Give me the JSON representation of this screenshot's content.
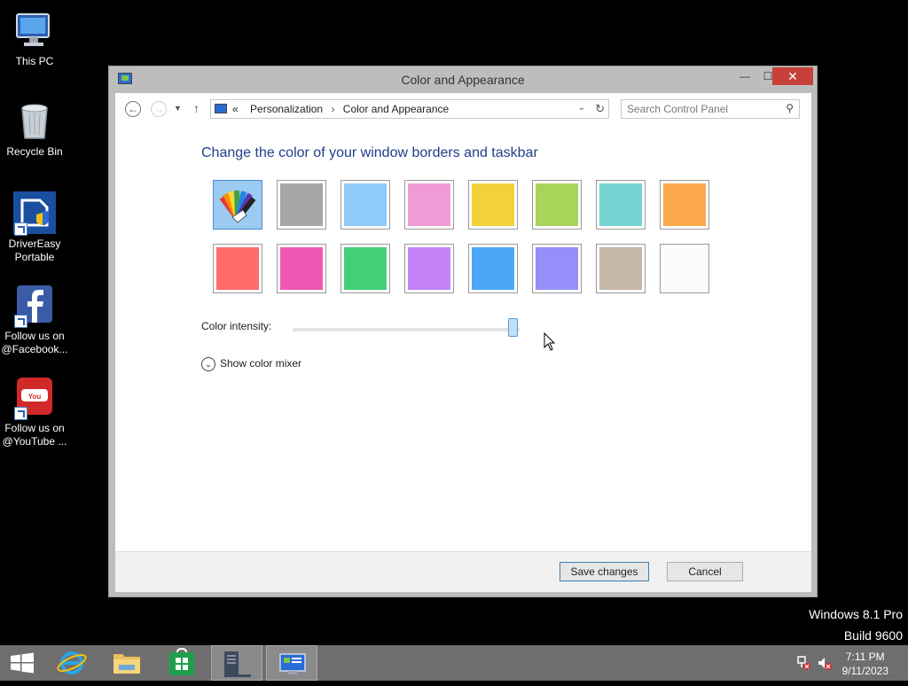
{
  "desktop": {
    "icons": [
      {
        "label": "This PC"
      },
      {
        "label": "Recycle Bin"
      },
      {
        "label": "DriverEasy\nPortable"
      },
      {
        "label": "Follow us on\n@Facebook..."
      },
      {
        "label": "Follow us on\n@YouTube ..."
      }
    ]
  },
  "window": {
    "title": "Color and Appearance",
    "caption": {
      "minimize": "—",
      "maximize": "☐",
      "close": "✕"
    }
  },
  "navigation": {
    "breadcrumb_prefix": "«",
    "breadcrumbs": [
      "Personalization",
      "Color and Appearance"
    ],
    "search_placeholder": "Search Control Panel"
  },
  "content": {
    "heading": "Change the color of your window borders and taskbar",
    "swatches": [
      {
        "name": "automatic",
        "color": "#9ccbf2"
      },
      {
        "name": "gray",
        "color": "#a6a6a6"
      },
      {
        "name": "sky-blue",
        "color": "#8fcaf9"
      },
      {
        "name": "pink",
        "color": "#f09ad6"
      },
      {
        "name": "yellow",
        "color": "#f2d23a"
      },
      {
        "name": "lime",
        "color": "#a9d45a"
      },
      {
        "name": "teal",
        "color": "#74d5d2"
      },
      {
        "name": "orange",
        "color": "#fba94c"
      },
      {
        "name": "red",
        "color": "#ff6b6b"
      },
      {
        "name": "magenta",
        "color": "#f158b4"
      },
      {
        "name": "green",
        "color": "#44cf76"
      },
      {
        "name": "violet",
        "color": "#c382f8"
      },
      {
        "name": "blue",
        "color": "#4aa8f7"
      },
      {
        "name": "periwinkle",
        "color": "#9590f9"
      },
      {
        "name": "taupe",
        "color": "#c5b6a8"
      },
      {
        "name": "white",
        "color": "#fbfbfb"
      }
    ],
    "selected_swatch": "automatic",
    "intensity_label": "Color intensity:",
    "intensity_value": 0.97,
    "mixer_label": "Show color mixer"
  },
  "footer": {
    "save_label": "Save changes",
    "cancel_label": "Cancel"
  },
  "watermark": {
    "edition": "Windows 8.1 Pro",
    "build": "Build 9600"
  },
  "taskbar": {
    "items": [
      "start",
      "internet-explorer",
      "file-explorer",
      "store",
      "server-manager",
      "control-panel"
    ],
    "active_items": [
      "server-manager",
      "control-panel"
    ],
    "clock_time": "7:11 PM",
    "clock_date": "9/11/2023"
  }
}
